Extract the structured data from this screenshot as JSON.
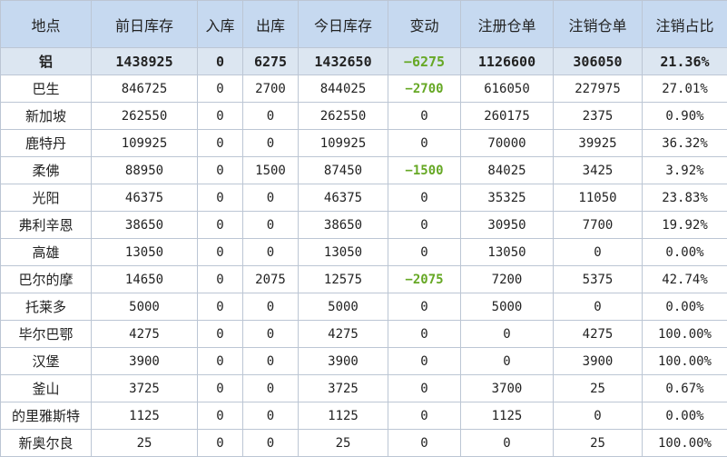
{
  "headers": [
    "地点",
    "前日库存",
    "入库",
    "出库",
    "今日库存",
    "变动",
    "注册仓单",
    "注销仓单",
    "注销占比"
  ],
  "summary": [
    "铝",
    "1438925",
    "0",
    "6275",
    "1432650",
    "−6275",
    "1126600",
    "306050",
    "21.36%"
  ],
  "rows": [
    [
      "巴生",
      "846725",
      "0",
      "2700",
      "844025",
      "−2700",
      "616050",
      "227975",
      "27.01%"
    ],
    [
      "新加坡",
      "262550",
      "0",
      "0",
      "262550",
      "0",
      "260175",
      "2375",
      "0.90%"
    ],
    [
      "鹿特丹",
      "109925",
      "0",
      "0",
      "109925",
      "0",
      "70000",
      "39925",
      "36.32%"
    ],
    [
      "柔佛",
      "88950",
      "0",
      "1500",
      "87450",
      "−1500",
      "84025",
      "3425",
      "3.92%"
    ],
    [
      "光阳",
      "46375",
      "0",
      "0",
      "46375",
      "0",
      "35325",
      "11050",
      "23.83%"
    ],
    [
      "弗利辛恩",
      "38650",
      "0",
      "0",
      "38650",
      "0",
      "30950",
      "7700",
      "19.92%"
    ],
    [
      "高雄",
      "13050",
      "0",
      "0",
      "13050",
      "0",
      "13050",
      "0",
      "0.00%"
    ],
    [
      "巴尔的摩",
      "14650",
      "0",
      "2075",
      "12575",
      "−2075",
      "7200",
      "5375",
      "42.74%"
    ],
    [
      "托莱多",
      "5000",
      "0",
      "0",
      "5000",
      "0",
      "5000",
      "0",
      "0.00%"
    ],
    [
      "毕尔巴鄂",
      "4275",
      "0",
      "0",
      "4275",
      "0",
      "0",
      "4275",
      "100.00%"
    ],
    [
      "汉堡",
      "3900",
      "0",
      "0",
      "3900",
      "0",
      "0",
      "3900",
      "100.00%"
    ],
    [
      "釜山",
      "3725",
      "0",
      "0",
      "3725",
      "0",
      "3700",
      "25",
      "0.67%"
    ],
    [
      "的里雅斯特",
      "1125",
      "0",
      "0",
      "1125",
      "0",
      "1125",
      "0",
      "0.00%"
    ],
    [
      "新奥尔良",
      "25",
      "0",
      "0",
      "25",
      "0",
      "0",
      "25",
      "100.00%"
    ]
  ],
  "colors": {
    "header_bg": "#c6d9f0",
    "summary_bg": "#dce6f1",
    "negative_change": "#66a825",
    "grid_line": "#bcc6d4"
  }
}
